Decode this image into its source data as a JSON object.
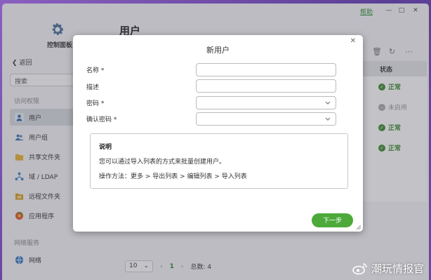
{
  "window": {
    "help_label": "帮助",
    "minimize_glyph": "—",
    "maximize_glyph": "□",
    "close_glyph": "✕"
  },
  "sidebar": {
    "app_title": "控制面板",
    "back_label": "返回",
    "search_placeholder": "搜索",
    "sections": [
      {
        "label": "访问权限"
      },
      {
        "label": "网络服务"
      }
    ],
    "items": [
      {
        "label": "用户",
        "icon": "user-icon",
        "active": true
      },
      {
        "label": "用户组",
        "icon": "user-group-icon",
        "active": false
      },
      {
        "label": "共享文件夹",
        "icon": "folder-icon",
        "active": false
      },
      {
        "label": "域 / LDAP",
        "icon": "domain-icon",
        "active": false
      },
      {
        "label": "远程文件夹",
        "icon": "remote-folder-icon",
        "active": false
      },
      {
        "label": "应用程序",
        "icon": "apps-icon",
        "active": false
      },
      {
        "label": "网络",
        "icon": "network-icon",
        "active": false
      }
    ]
  },
  "main": {
    "page_title": "用户",
    "table": {
      "status_header": "状态",
      "rows": [
        {
          "status": "正常",
          "enabled": true
        },
        {
          "status": "未启用",
          "enabled": false
        },
        {
          "status": "正常",
          "enabled": true
        },
        {
          "status": "正常",
          "enabled": true
        }
      ]
    },
    "pager": {
      "page_size": "10",
      "current_page": "1",
      "total_label": "总数: 4"
    }
  },
  "dialog": {
    "title": "新用户",
    "fields": {
      "name_label": "名称 *",
      "description_label": "描述",
      "password_label": "密码 *",
      "confirm_password_label": "确认密码 *"
    },
    "info": {
      "title": "说明",
      "line1": "您可以通过导入列表的方式来批量创建用户。",
      "line2": "操作方法：更多 > 导出列表 > 编辑列表 > 导入列表"
    },
    "next_label": "下一步"
  },
  "watermark": {
    "text": "潮玩情报官"
  },
  "colors": {
    "accent_green": "#4daa3a",
    "status_ok": "#3a8a2e",
    "background_purple": "#6a4aa8"
  }
}
